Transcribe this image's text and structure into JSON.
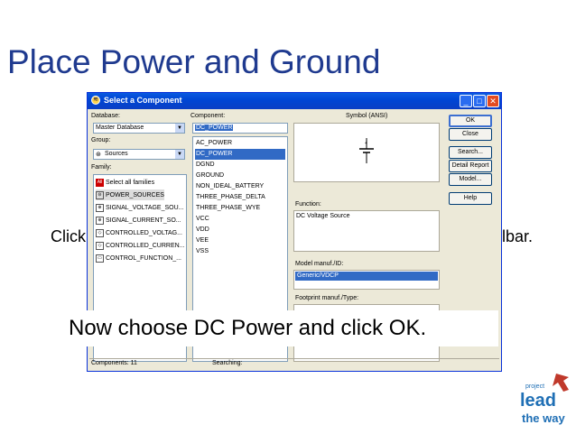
{
  "slide": {
    "title": "Place Power and Ground",
    "click_left": "Click",
    "click_right": "lbar.",
    "caption": "Now choose DC Power and click OK."
  },
  "dialog": {
    "title": "Select a Component",
    "database_label": "Database:",
    "database_value": "Master Database",
    "group_label": "Group:",
    "group_value": "Sources",
    "family_label": "Family:",
    "families": [
      {
        "label": "Select all families",
        "icon": "all-families-icon",
        "selected": false
      },
      {
        "label": "POWER_SOURCES",
        "icon": "power-source-icon",
        "selected": true
      },
      {
        "label": "SIGNAL_VOLTAGE_SOU...",
        "icon": "signal-voltage-icon",
        "selected": false
      },
      {
        "label": "SIGNAL_CURRENT_SO...",
        "icon": "signal-current-icon",
        "selected": false
      },
      {
        "label": "CONTROLLED_VOLTAG...",
        "icon": "controlled-voltage-icon",
        "selected": false
      },
      {
        "label": "CONTROLLED_CURREN...",
        "icon": "controlled-current-icon",
        "selected": false
      },
      {
        "label": "CONTROL_FUNCTION_...",
        "icon": "control-function-icon",
        "selected": false
      }
    ],
    "component_label": "Component:",
    "component_value": "DC_POWER",
    "components": [
      {
        "label": "AC_POWER",
        "selected": false
      },
      {
        "label": "DC_POWER",
        "selected": true
      },
      {
        "label": "DGND",
        "selected": false
      },
      {
        "label": "GROUND",
        "selected": false
      },
      {
        "label": "NON_IDEAL_BATTERY",
        "selected": false
      },
      {
        "label": "THREE_PHASE_DELTA",
        "selected": false
      },
      {
        "label": "THREE_PHASE_WYE",
        "selected": false
      },
      {
        "label": "VCC",
        "selected": false
      },
      {
        "label": "VDD",
        "selected": false
      },
      {
        "label": "VEE",
        "selected": false
      },
      {
        "label": "VSS",
        "selected": false
      }
    ],
    "symbol_label": "Symbol (ANSI)",
    "function_label": "Function:",
    "function_value": "DC Voltage Source",
    "model_label": "Model manuf./ID:",
    "model_value": "Generic/VDCP",
    "footprint_label": "Footprint manuf./Type:",
    "buttons": {
      "ok": "OK",
      "close": "Close",
      "search": "Search...",
      "detail_report": "Detail Report",
      "model": "Model...",
      "help": "Help"
    },
    "status_components": "Components: 11",
    "status_searching": "Searching:"
  },
  "logo": {
    "line1": "project",
    "line2": "lead",
    "line3": "the way"
  },
  "colors": {
    "title_blue": "#1f3a8f",
    "xp_blue": "#0a5ae0",
    "selection": "#316ac5"
  }
}
